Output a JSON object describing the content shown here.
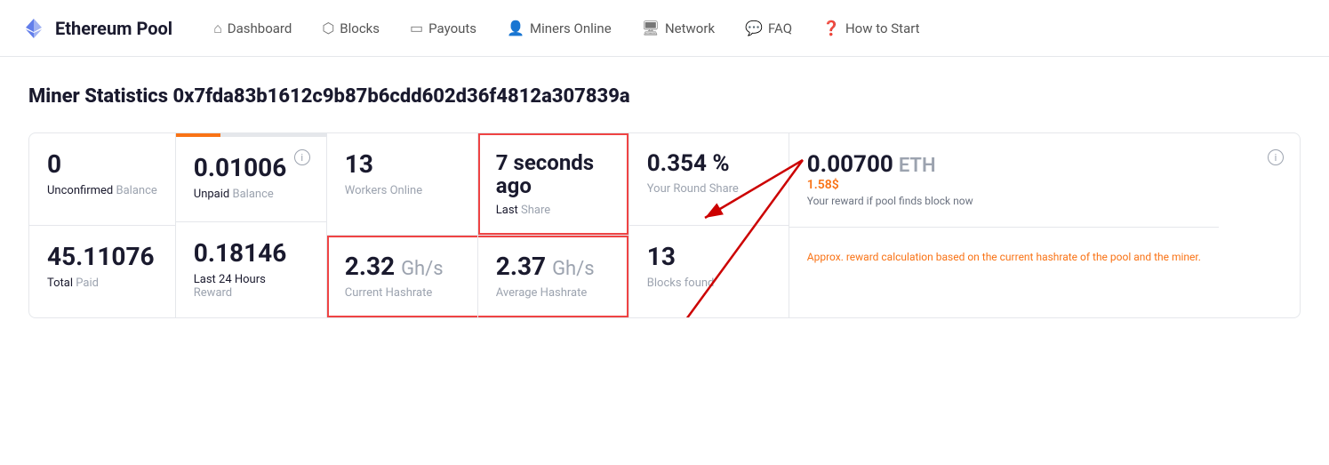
{
  "brand": {
    "name": "Ethereum Pool",
    "logo_unicode": "◆"
  },
  "nav": {
    "items": [
      {
        "label": "Dashboard",
        "icon": "🏠",
        "id": "dashboard"
      },
      {
        "label": "Blocks",
        "icon": "📦",
        "id": "blocks"
      },
      {
        "label": "Payouts",
        "icon": "💳",
        "id": "payouts"
      },
      {
        "label": "Miners Online",
        "icon": "👥",
        "id": "miners-online"
      },
      {
        "label": "Network",
        "icon": "🖥",
        "id": "network"
      },
      {
        "label": "FAQ",
        "icon": "💬",
        "id": "faq"
      },
      {
        "label": "How to Start",
        "icon": "❓",
        "id": "how-to-start"
      }
    ]
  },
  "page": {
    "title": "Miner Statistics 0x7fda83b1612c9b87b6cdd602d36f4812a307839a"
  },
  "stats": {
    "unconfirmed_balance": {
      "value": "0",
      "label_prefix": "Unconfirmed",
      "label_suffix": "Balance"
    },
    "unpaid_balance": {
      "value": "0.01006",
      "label_prefix": "Unpaid",
      "label_suffix": "Balance",
      "progress": 30
    },
    "total_paid": {
      "value": "45.11076",
      "label_prefix": "Total",
      "label_suffix": "Paid"
    },
    "last_24h_reward": {
      "value": "0.18146",
      "label": "Last 24 Hours",
      "label2": "Reward"
    },
    "workers_online": {
      "value": "13",
      "label": "Workers Online"
    },
    "last_share": {
      "value": "7 seconds ago",
      "label_prefix": "Last",
      "label_suffix": "Share"
    },
    "current_hashrate": {
      "value": "2.32",
      "unit": "Gh/s",
      "label": "Current Hashrate"
    },
    "average_hashrate": {
      "value": "2.37",
      "unit": "Gh/s",
      "label": "Average Hashrate"
    },
    "round_share": {
      "value": "0.354 %",
      "label": "Your Round Share"
    },
    "blocks_found": {
      "value": "13",
      "label": "Blocks found"
    },
    "eth_reward": {
      "value": "0.00700",
      "unit": "ETH",
      "usd": "1.58$",
      "desc": "Your reward if pool finds block now",
      "approx": "Approx. reward calculation based on the current hashrate of the pool and the miner."
    }
  }
}
